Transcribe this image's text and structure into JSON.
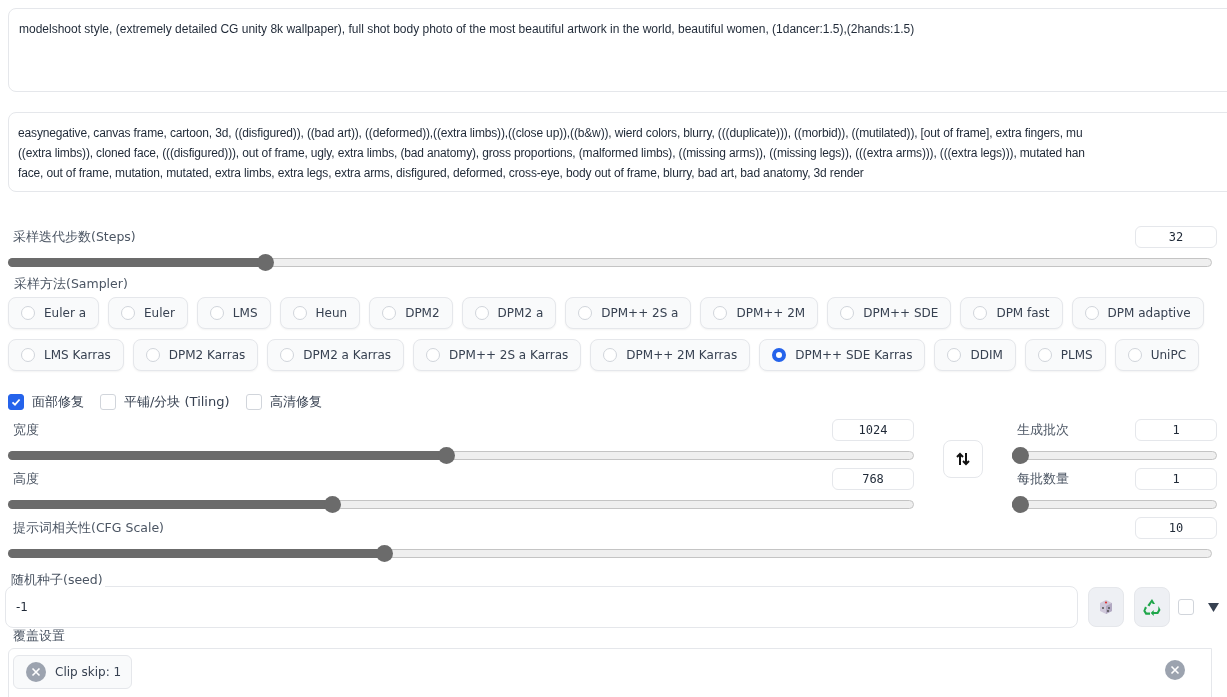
{
  "prompt": {
    "value": "modelshoot style, (extremely detailed CG unity 8k wallpaper), full shot body photo of the most beautiful artwork in the world, beautiful women, (1dancer:1.5),(2hands:1.5)"
  },
  "negative_prompt": {
    "lines": [
      "easynegative, canvas frame, cartoon, 3d, ((disfigured)), ((bad art)), ((deformed)),((extra limbs)),((close up)),((b&w)), wierd colors, blurry, (((duplicate))), ((morbid)), ((mutilated)), [out of frame], extra fingers, mu",
      "((extra limbs)), cloned face, (((disfigured))), out of frame, ugly, extra limbs, (bad anatomy), gross proportions, (malformed limbs), ((missing arms)), ((missing legs)), (((extra arms))), (((extra legs))), mutated han",
      "face, out of frame, mutation, mutated, extra limbs, extra legs, extra arms, disfigured, deformed, cross-eye, body out of frame, blurry, bad art, bad anatomy, 3d render"
    ]
  },
  "steps": {
    "label": "采样迭代步数(Steps)",
    "value": "32",
    "level": 0.21
  },
  "sampler": {
    "label": "采样方法(Sampler)",
    "options": [
      {
        "label": "Euler a",
        "selected": false
      },
      {
        "label": "Euler",
        "selected": false
      },
      {
        "label": "LMS",
        "selected": false
      },
      {
        "label": "Heun",
        "selected": false
      },
      {
        "label": "DPM2",
        "selected": false
      },
      {
        "label": "DPM2 a",
        "selected": false
      },
      {
        "label": "DPM++ 2S a",
        "selected": false
      },
      {
        "label": "DPM++ 2M",
        "selected": false
      },
      {
        "label": "DPM++ SDE",
        "selected": false
      },
      {
        "label": "DPM fast",
        "selected": false
      },
      {
        "label": "DPM adaptive",
        "selected": false
      },
      {
        "label": "LMS Karras",
        "selected": false
      },
      {
        "label": "DPM2 Karras",
        "selected": false
      },
      {
        "label": "DPM2 a Karras",
        "selected": false
      },
      {
        "label": "DPM++ 2S a Karras",
        "selected": false
      },
      {
        "label": "DPM++ 2M Karras",
        "selected": false
      },
      {
        "label": "DPM++ SDE Karras",
        "selected": true
      },
      {
        "label": "DDIM",
        "selected": false
      },
      {
        "label": "PLMS",
        "selected": false
      },
      {
        "label": "UniPC",
        "selected": false
      }
    ]
  },
  "options": [
    {
      "label": "面部修复",
      "checked": true
    },
    {
      "label": "平铺/分块 (Tiling)",
      "checked": false
    },
    {
      "label": "高清修复",
      "checked": false
    }
  ],
  "width": {
    "label": "宽度",
    "value": "1024",
    "level": 0.484
  },
  "height": {
    "label": "高度",
    "value": "768",
    "level": 0.356
  },
  "batch_count": {
    "label": "生成批次",
    "value": "1",
    "level": 0
  },
  "batch_size": {
    "label": "每批数量",
    "value": "1",
    "level": 0
  },
  "cfg_scale": {
    "label": "提示词相关性(CFG Scale)",
    "value": "10",
    "level": 0.31
  },
  "seed": {
    "label": "随机种子(seed)",
    "value": "-1",
    "extra_checked": false
  },
  "override": {
    "label": "覆盖设置",
    "chips": [
      "Clip skip: 1"
    ]
  }
}
